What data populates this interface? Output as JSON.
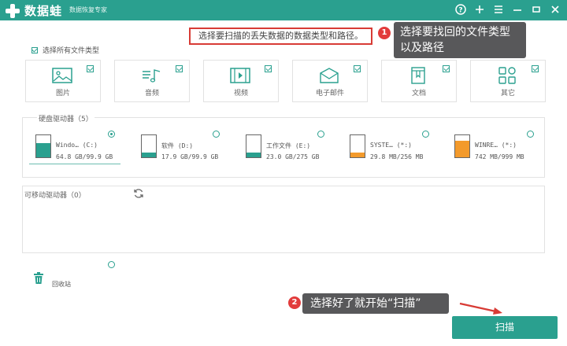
{
  "app": {
    "name": "数据蛙",
    "subtitle": "数据恢复专家"
  },
  "window_controls": [
    "help-icon",
    "add-icon",
    "menu-icon",
    "minimize-icon",
    "maximize-icon",
    "close-icon"
  ],
  "instruction": "选择要扫描的丢失数据的数据类型和路径。",
  "select_all_label": "选择所有文件类型",
  "file_types": [
    {
      "label": "图片",
      "icon": "image-icon",
      "checked": true
    },
    {
      "label": "音频",
      "icon": "audio-icon",
      "checked": true
    },
    {
      "label": "视频",
      "icon": "video-icon",
      "checked": true
    },
    {
      "label": "电子邮件",
      "icon": "email-icon",
      "checked": true
    },
    {
      "label": "文档",
      "icon": "document-icon",
      "checked": true
    },
    {
      "label": "其它",
      "icon": "other-icon",
      "checked": true
    }
  ],
  "hard_drives": {
    "title": "硬盘驱动器（5）",
    "drives": [
      {
        "name": "Windo… (C:)",
        "size": "64.8 GB/99.9 GB",
        "selected": true,
        "fill_color": "#2aa08f",
        "used_fraction": 0.65
      },
      {
        "name": "软件 (D:)",
        "size": "17.9 GB/99.9 GB",
        "selected": false,
        "fill_color": "#2aa08f",
        "used_fraction": 0.18
      },
      {
        "name": "工作文件 (E:)",
        "size": "23.0 GB/275 GB",
        "selected": false,
        "fill_color": "#2aa08f",
        "used_fraction": 0.08
      },
      {
        "name": "SYSTE… (*:)",
        "size": "29.8 MB/256 MB",
        "selected": false,
        "fill_color": "#f39a2b",
        "used_fraction": 0.12
      },
      {
        "name": "WINRE… (*:)",
        "size": "742 MB/999 MB",
        "selected": false,
        "fill_color": "#f39a2b",
        "used_fraction": 0.74
      }
    ]
  },
  "removable": {
    "title": "可移动驱动器（0）"
  },
  "recycle_bin_label": "回收站",
  "scan_button": "扫描",
  "callouts": {
    "step1_number": "1",
    "step1_text": "选择要找回的文件类型以及路径",
    "step2_number": "2",
    "step2_text": "选择好了就开始“扫描”"
  },
  "colors": {
    "brand": "#2aa08f",
    "accent_orange": "#f39a2b",
    "highlight_red": "#d83b35",
    "callout_bg": "#58585a"
  }
}
